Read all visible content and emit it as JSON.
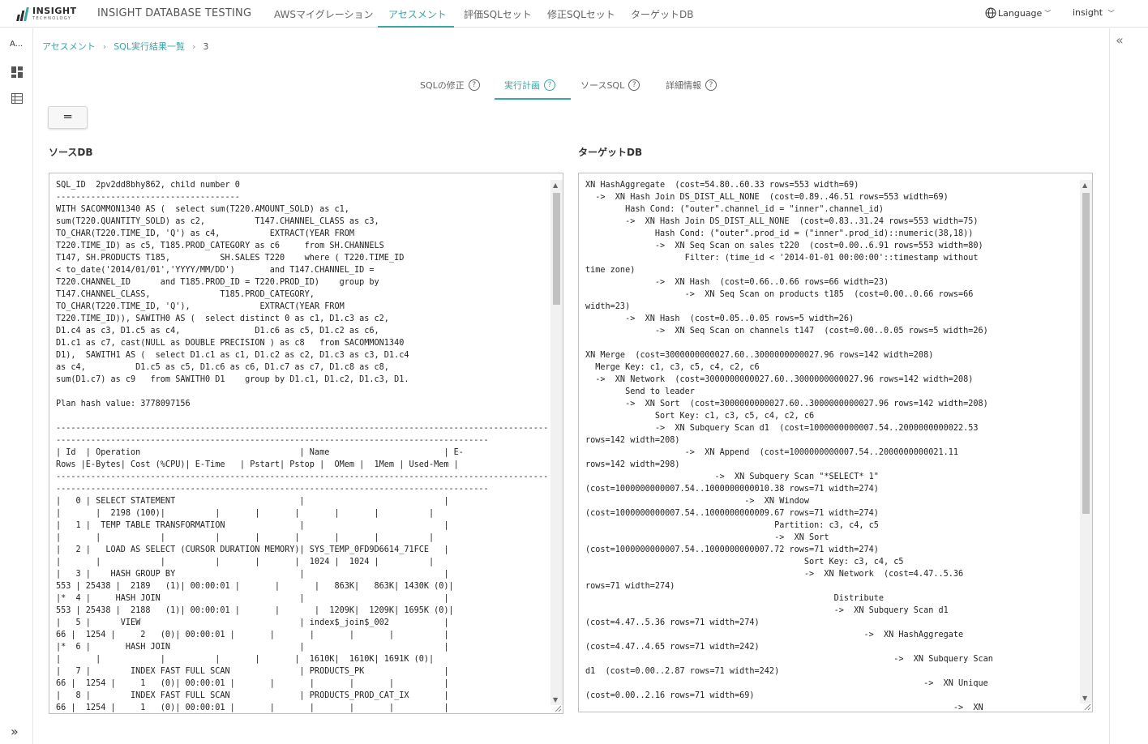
{
  "topnav": {
    "logo_main": "INSIGHT",
    "logo_sub": "TECHNOLOGY",
    "brand": "INSIGHT DATABASE TESTING",
    "tabs": [
      "AWSマイグレーション",
      "アセスメント",
      "評価SQLセット",
      "修正SQLセット",
      "ターゲットDB"
    ],
    "active_tab": "アセスメント",
    "language": "Language",
    "user": "insight"
  },
  "rail": {
    "label": "A..."
  },
  "breadcrumb": {
    "items": [
      "アセスメント",
      "SQL実行結果一覧"
    ],
    "current": "3"
  },
  "subtabs": [
    {
      "label": "SQLの修正"
    },
    {
      "label": "実行計画"
    },
    {
      "label": "ソースSQL"
    },
    {
      "label": "詳細情報"
    }
  ],
  "active_subtab": "実行計画",
  "menu_button": "═",
  "source": {
    "title": "ソースDB",
    "text": "SQL_ID  2pv2dd8bhy862, child number 0\n-------------------------------------\nWITH SACOMMON1340 AS (  select sum(T220.AMOUNT_SOLD) as c1,\nsum(T220.QUANTITY_SOLD) as c2,          T147.CHANNEL_CLASS as c3,\nTO_CHAR(T220.TIME_ID, 'Q') as c4,          EXTRACT(YEAR FROM\nT220.TIME_ID) as c5, T185.PROD_CATEGORY as c6     from SH.CHANNELS\nT147, SH.PRODUCTS T185,          SH.SALES T220    where ( T220.TIME_ID\n< to_date('2014/01/01','YYYY/MM/DD')       and T147.CHANNEL_ID =\nT220.CHANNEL_ID      and T185.PROD_ID = T220.PROD_ID)    group by\nT147.CHANNEL_CLASS,              T185.PROD_CATEGORY,\nTO_CHAR(T220.TIME_ID, 'Q'),              EXTRACT(YEAR FROM\nT220.TIME_ID)), SAWITH0 AS (  select distinct 0 as c1, D1.c3 as c2,\nD1.c4 as c3, D1.c5 as c4,               D1.c6 as c5, D1.c2 as c6,\nD1.c1 as c7, cast(NULL as DOUBLE PRECISION ) as c8   from SACOMMON1340\nD1),  SAWITH1 AS (  select D1.c1 as c1, D1.c2 as c2, D1.c3 as c3, D1.c4\nas c4,          D1.c5 as c5, D1.c6 as c6, D1.c7 as c7, D1.c8 as c8,\nsum(D1.c7) as c9   from SAWITH0 D1    group by D1.c1, D1.c2, D1.c3, D1.\n\nPlan hash value: 3778097156\n\n---------------------------------------------------------------------------------------------------\n---------------------------------------------------------------------------------------\n| Id  | Operation                                | Name                       | E-\nRows |E-Bytes| Cost (%CPU)| E-Time   | Pstart| Pstop |  OMem |  1Mem | Used-Mem |\n---------------------------------------------------------------------------------------------------\n---------------------------------------------------------------------------------------\n|   0 | SELECT STATEMENT                         |                            |\n|       |  2198 (100)|          |       |       |       |       |          |\n|   1 |  TEMP TABLE TRANSFORMATION               |                            |\n|       |            |          |       |       |       |       |          |\n|   2 |   LOAD AS SELECT (CURSOR DURATION MEMORY)| SYS_TEMP_0FD9D6614_71FCE   |\n|       |            |          |       |       |  1024 |  1024 |          |\n|   3 |    HASH GROUP BY                         |                            |\n553 | 25438 |  2189   (1)| 00:00:01 |       |       |   863K|   863K| 1430K (0)|\n|*  4 |     HASH JOIN                            |                            |\n553 | 25438 |  2188   (1)| 00:00:01 |       |       |  1209K|  1209K| 1695K (0)|\n|   5 |      VIEW                                | index$_join$_002           |\n66 |  1254 |     2   (0)| 00:00:01 |       |       |       |       |          |\n|*  6 |       HASH JOIN                          |                            |\n|       |            |          |       |       |  1610K|  1610K| 1691K (0)|\n|   7 |        INDEX FAST FULL SCAN              | PRODUCTS_PK                |\n66 |  1254 |     1   (0)| 00:00:01 |       |       |       |       |          |\n|   8 |        INDEX FAST FULL SCAN              | PRODUCTS_PROD_CAT_IX       |\n66 |  1254 |     1   (0)| 00:00:01 |       |       |       |       |          |"
  },
  "target": {
    "title": "ターゲットDB",
    "text": "XN HashAggregate  (cost=54.80..60.33 rows=553 width=69)\n  ->  XN Hash Join DS_DIST_ALL_NONE  (cost=0.89..46.51 rows=553 width=69)\n        Hash Cond: (\"outer\".channel_id = \"inner\".channel_id)\n        ->  XN Hash Join DS_DIST_ALL_NONE  (cost=0.83..31.24 rows=553 width=75)\n              Hash Cond: (\"outer\".prod_id = (\"inner\".prod_id)::numeric(38,18))\n              ->  XN Seq Scan on sales t220  (cost=0.00..6.91 rows=553 width=80)\n                    Filter: (time_id < '2014-01-01 00:00:00'::timestamp without\ntime zone)\n              ->  XN Hash  (cost=0.66..0.66 rows=66 width=23)\n                    ->  XN Seq Scan on products t185  (cost=0.00..0.66 rows=66\nwidth=23)\n        ->  XN Hash  (cost=0.05..0.05 rows=5 width=26)\n              ->  XN Seq Scan on channels t147  (cost=0.00..0.05 rows=5 width=26)\n\nXN Merge  (cost=3000000000027.60..3000000000027.96 rows=142 width=208)\n  Merge Key: c1, c3, c5, c4, c2, c6\n  ->  XN Network  (cost=3000000000027.60..3000000000027.96 rows=142 width=208)\n        Send to leader\n        ->  XN Sort  (cost=3000000000027.60..3000000000027.96 rows=142 width=208)\n              Sort Key: c1, c3, c5, c4, c2, c6\n              ->  XN Subquery Scan d1  (cost=1000000000007.54..2000000000022.53\nrows=142 width=208)\n                    ->  XN Append  (cost=1000000000007.54..2000000000021.11\nrows=142 width=298)\n                          ->  XN Subquery Scan \"*SELECT* 1\"\n(cost=1000000000007.54..1000000000010.38 rows=71 width=274)\n                                ->  XN Window\n(cost=1000000000007.54..1000000000009.67 rows=71 width=274)\n                                      Partition: c3, c4, c5\n                                      ->  XN Sort\n(cost=1000000000007.54..1000000000007.72 rows=71 width=274)\n                                            Sort Key: c3, c4, c5\n                                            ->  XN Network  (cost=4.47..5.36\nrows=71 width=274)\n                                                  Distribute\n                                                  ->  XN Subquery Scan d1\n(cost=4.47..5.36 rows=71 width=274)\n                                                        ->  XN HashAggregate\n(cost=4.47..4.65 rows=71 width=242)\n                                                              ->  XN Subquery Scan\nd1  (cost=0.00..2.87 rows=71 width=242)\n                                                                    ->  XN Unique\n(cost=0.00..2.16 rows=71 width=69)\n                                                                          ->  XN"
  }
}
